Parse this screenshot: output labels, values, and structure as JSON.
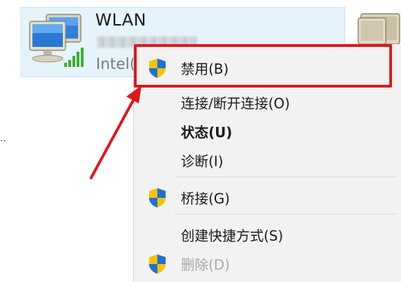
{
  "adapter": {
    "name": "WLAN",
    "driver": "Intel(",
    "icon": "network-adapter-icon"
  },
  "side_text": "..",
  "context_menu": {
    "items": [
      {
        "label": "禁用(B)",
        "icon": "uac-shield-icon",
        "bold": false,
        "disabled": false
      },
      {
        "label": "连接/断开连接(O)",
        "icon": null,
        "bold": false,
        "disabled": false
      },
      {
        "label": "状态(U)",
        "icon": null,
        "bold": true,
        "disabled": false
      },
      {
        "label": "诊断(I)",
        "icon": null,
        "bold": false,
        "disabled": false
      },
      {
        "label": "桥接(G)",
        "icon": "uac-shield-icon",
        "bold": false,
        "disabled": false
      },
      {
        "label": "创建快捷方式(S)",
        "icon": null,
        "bold": false,
        "disabled": false
      },
      {
        "label": "删除(D)",
        "icon": "uac-shield-icon",
        "bold": false,
        "disabled": true
      }
    ]
  },
  "colors": {
    "highlight": "#e0161b",
    "selection_bg": "#e5f3fb",
    "menu_bg": "#f2f2f2"
  }
}
